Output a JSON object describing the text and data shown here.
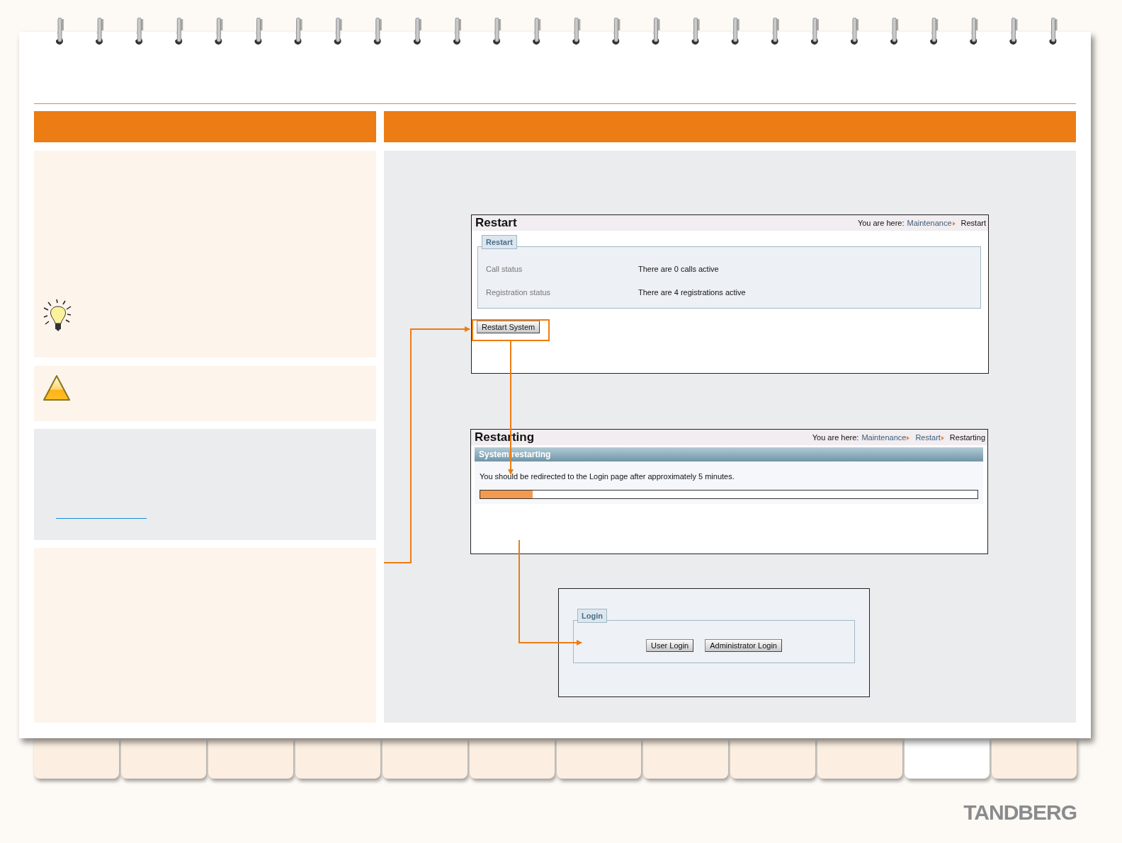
{
  "screenshots": [
    {
      "kind": "restart",
      "title": "Restart",
      "breadcrumb": {
        "label": "You are here:",
        "links": [
          "Maintenance"
        ],
        "current": "Restart"
      },
      "section": "Restart",
      "rows": [
        {
          "label": "Call status",
          "value": "There are 0 calls active"
        },
        {
          "label": "Registration status",
          "value": "There are 4 registrations active"
        }
      ],
      "button": "Restart System"
    },
    {
      "kind": "restarting",
      "title": "Restarting",
      "breadcrumb": {
        "label": "You are here:",
        "links": [
          "Maintenance",
          "Restart"
        ],
        "current": "Restarting"
      },
      "section": "System restarting",
      "message": "You should be redirected to the Login page after approximately 5 minutes.",
      "progress": {
        "level": 0.105
      }
    },
    {
      "kind": "login",
      "section": "Login",
      "buttons": [
        "User Login",
        "Administrator Login"
      ]
    }
  ],
  "tabs": [
    {
      "selected": false
    },
    {
      "selected": false
    },
    {
      "selected": false
    },
    {
      "selected": false
    },
    {
      "selected": false
    },
    {
      "selected": false
    },
    {
      "selected": false
    },
    {
      "selected": false
    },
    {
      "selected": false
    },
    {
      "selected": false
    },
    {
      "selected": true
    },
    {
      "selected": false
    }
  ],
  "logo": "TANDBERG"
}
